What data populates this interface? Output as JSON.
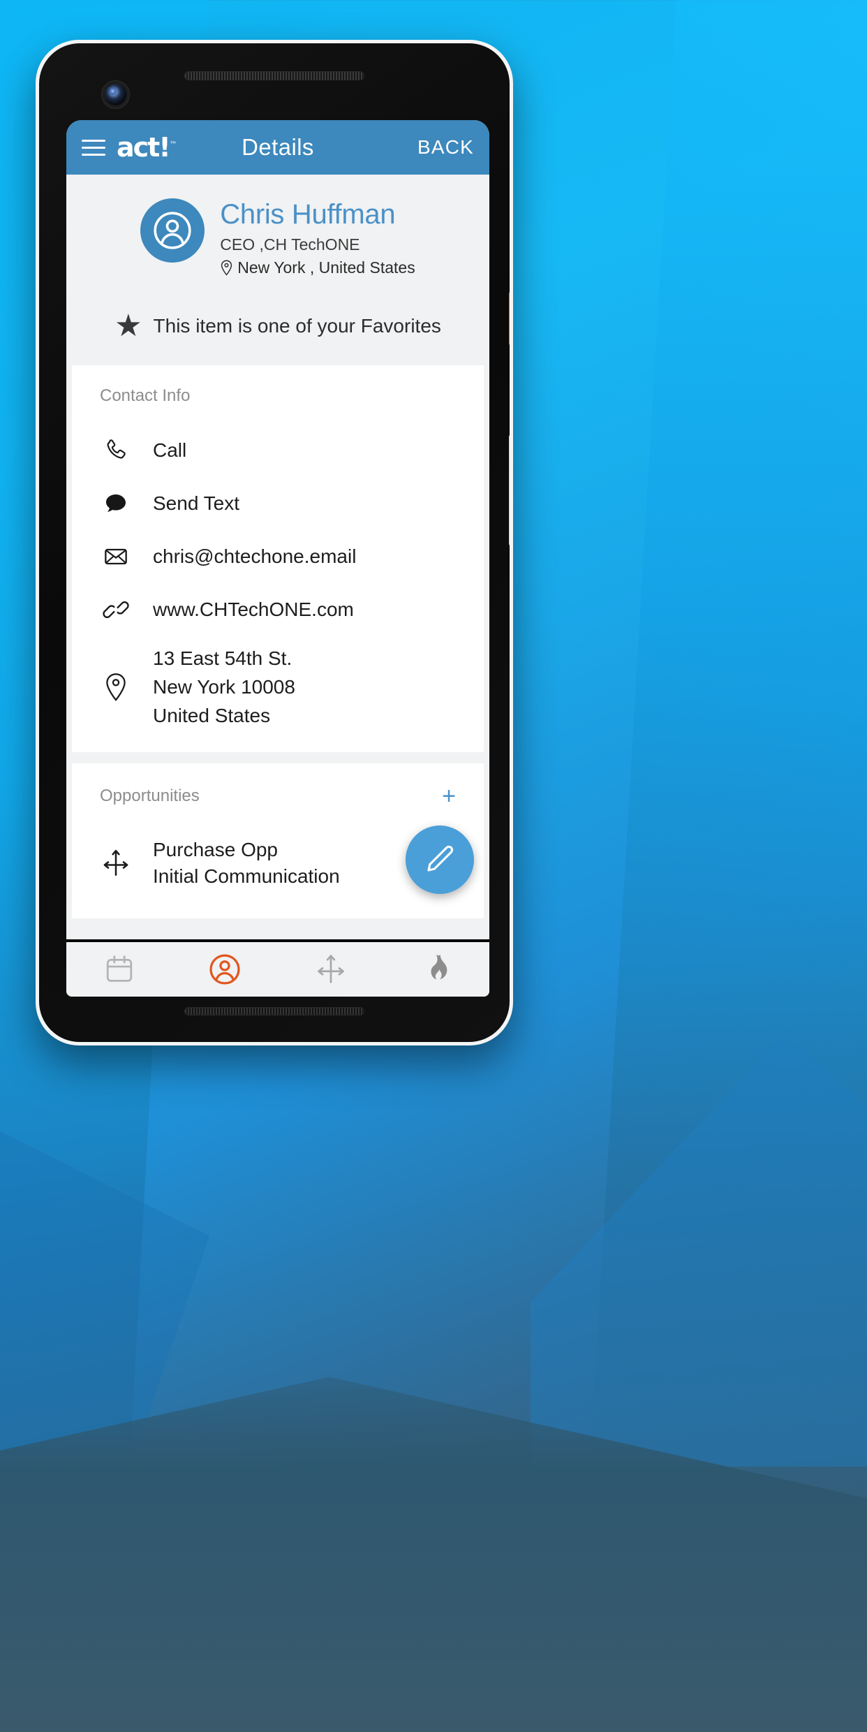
{
  "appbar": {
    "menu_icon": "hamburger-menu-icon",
    "logo": "act!",
    "logo_tm": "™",
    "title": "Details",
    "back_label": "BACK"
  },
  "contact": {
    "avatar_icon": "person-circle-icon",
    "name": "Chris Huffman",
    "job_title": "CEO ,CH TechONE",
    "location_icon": "map-pin-icon",
    "location": "New York , United States"
  },
  "favorite": {
    "icon": "star-icon",
    "text": "This item is one of your Favorites"
  },
  "contact_info": {
    "section_title": "Contact Info",
    "rows": [
      {
        "icon": "phone-icon",
        "label": "Call"
      },
      {
        "icon": "chat-bubble-icon",
        "label": "Send Text"
      },
      {
        "icon": "envelope-icon",
        "label": "chris@chtechone.email"
      },
      {
        "icon": "link-icon",
        "label": "www.CHTechONE.com"
      }
    ],
    "address": {
      "icon": "map-pin-icon",
      "line1": "13 East 54th St.",
      "line2": "New York 10008",
      "line3": "United States"
    }
  },
  "opportunities": {
    "section_title": "Opportunities",
    "add_label": "+",
    "rows": [
      {
        "icon": "opportunity-arrows-icon",
        "name": "Purchase Opp",
        "stage": "Initial Communication"
      }
    ]
  },
  "fab": {
    "icon": "pencil-edit-icon"
  },
  "bottom_nav": [
    {
      "icon": "calendar-icon",
      "active": false
    },
    {
      "icon": "contacts-icon",
      "active": true
    },
    {
      "icon": "opportunities-icon",
      "active": false
    },
    {
      "icon": "flame-icon",
      "active": false
    }
  ],
  "colors": {
    "appbar_blue": "#3d88bd",
    "accent_blue": "#4a91c8",
    "fab_blue": "#4a9fd8",
    "active_orange": "#e2561f",
    "screen_bg": "#f1f2f3"
  }
}
